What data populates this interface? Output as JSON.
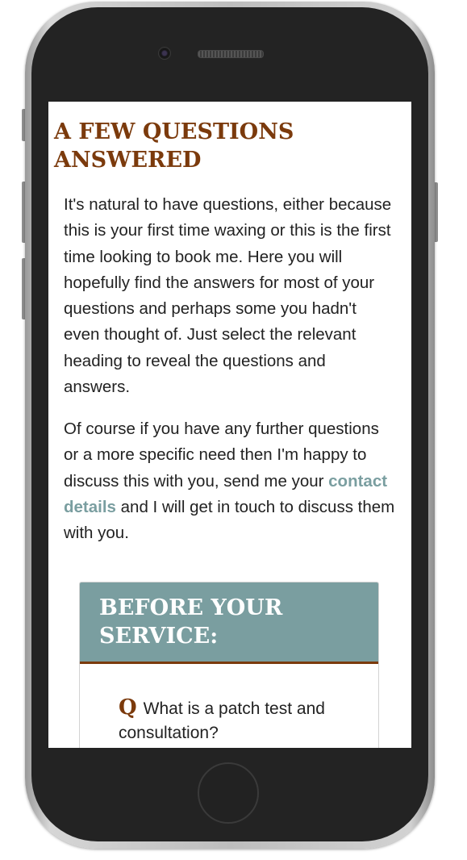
{
  "faq": {
    "title": "A FEW QUESTIONS ANSWERED",
    "intro": "It's natural to have questions, either because this is your first time waxing or this is the first time looking to book me. Here you will hopefully find the answers for most of your questions and perhaps some you hadn't even thought of. Just select the relevant heading to reveal the questions and answers.",
    "further_before": "Of course if you have any further questions or a more specific need then I'm happy to discuss this with you, send me your ",
    "contact_link": "contact details",
    "further_after": " and I will get in touch to discuss them with you."
  },
  "accordion": {
    "heading": "BEFORE YOUR SERVICE:",
    "q_marker": "Q",
    "question": "What is a patch test and consultation?"
  },
  "colors": {
    "heading_brown": "#7b3a0c",
    "accent_teal": "#7a9ea0",
    "text": "#222222",
    "phone_body": "#232323"
  }
}
